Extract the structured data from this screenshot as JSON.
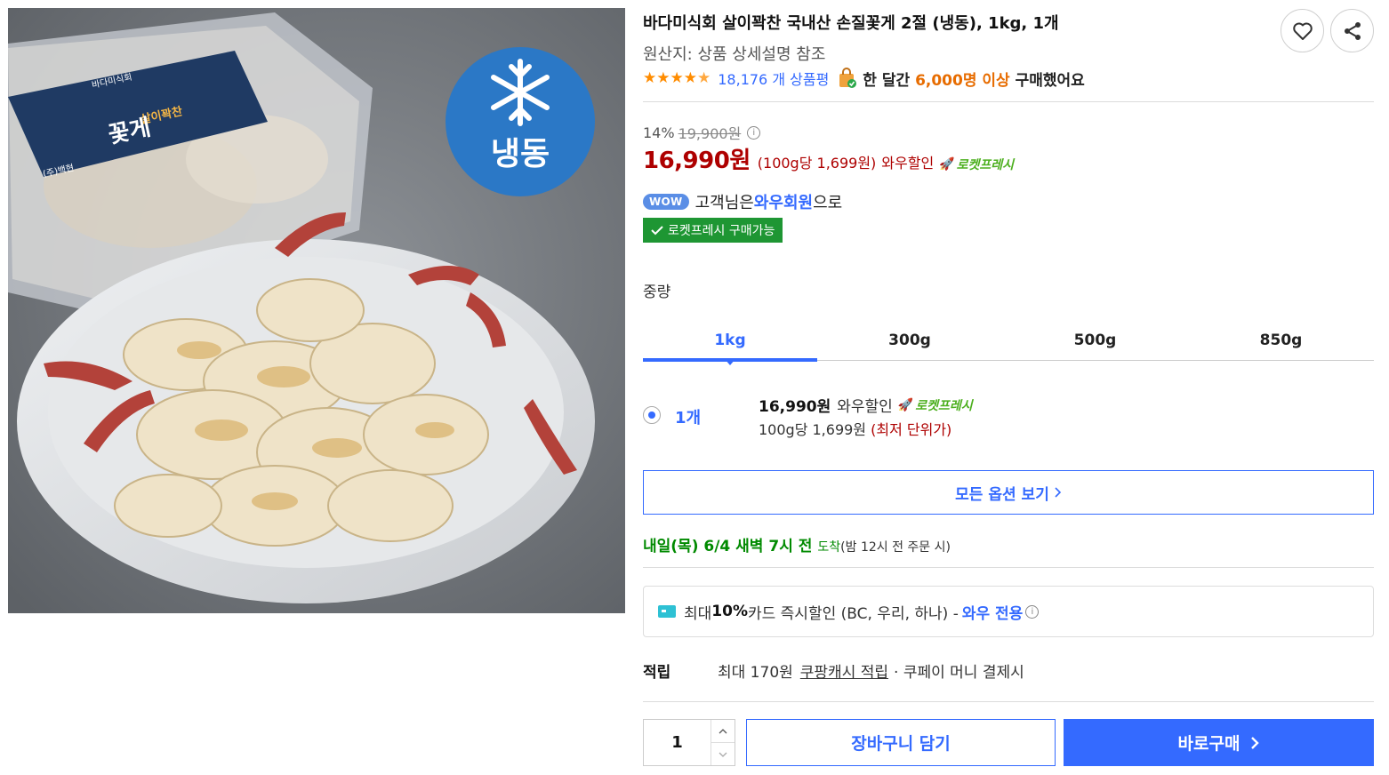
{
  "product": {
    "title": "바다미식회 살이꽉찬 국내산 손질꽃게 2절 (냉동), 1kg, 1개",
    "origin": "원산지: 상품 상세설명 참조",
    "image": {
      "badge_text": "냉동",
      "package_label": "꽃게",
      "package_sublabel": "살이꽉찬",
      "package_brand": "바다미식회",
      "package_maker": "(주)백현"
    }
  },
  "rating": {
    "stars": 4.5,
    "review_count": "18,176 개 상품평"
  },
  "purchase_stat": {
    "prefix": "한 달간 ",
    "highlight": "6,000명 이상",
    "suffix": " 구매했어요"
  },
  "pricing": {
    "discount_rate": "14%",
    "original_price": "19,900원",
    "sale_price": "16,990원",
    "unit_price": "(100g당 1,699원)",
    "wow_discount": "와우할인",
    "rocket_label": "로켓프레시"
  },
  "wow": {
    "badge": "WOW",
    "text_before": "고객님은 ",
    "member": "와우회원",
    "text_after": "으로"
  },
  "fresh_badge": "로켓프레시 구매가능",
  "weight": {
    "label": "중량",
    "tabs": [
      "1kg",
      "300g",
      "500g",
      "850g"
    ],
    "selected": "1kg"
  },
  "option": {
    "qty": "1개",
    "price": "16,990원",
    "wow": "와우할인",
    "rocket": "로켓프레시",
    "unit": "100g당 1,699원 ",
    "lowest": "(최저 단위가)"
  },
  "all_options_label": "모든 옵션 보기",
  "delivery": {
    "date": "내일(목) 6/4 새벽 7시 전",
    "arrive": "도착",
    "condition": "(밤 12시 전 주문 시)"
  },
  "card_promo": {
    "prefix": "최대 ",
    "bold": "10%",
    "text": " 카드 즉시할인 (BC, 우리, 하나) - ",
    "wow_only": "와우 전용"
  },
  "reward": {
    "label": "적립",
    "max": "최대 170원",
    "link": "쿠팡캐시 적립",
    "tail": "· 쿠페이 머니 결제시"
  },
  "buy_box": {
    "quantity": "1",
    "cart_label": "장바구니 담기",
    "buy_label": "바로구매"
  },
  "colors": {
    "accent": "#346aff",
    "price_red": "#ae0000",
    "fresh_green": "#1e9633",
    "star_orange": "#ff8c00"
  }
}
